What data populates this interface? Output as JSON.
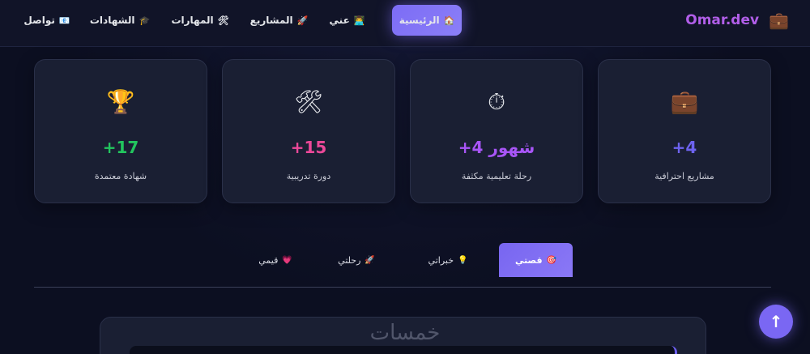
{
  "brand": {
    "name": "Omar.dev",
    "icon": "💼"
  },
  "nav": {
    "items": [
      {
        "label": "تواصل",
        "icon": "📧"
      },
      {
        "label": "الشهادات",
        "icon": "🎓"
      },
      {
        "label": "المهارات",
        "icon": "🛠"
      },
      {
        "label": "المشاريع",
        "icon": "🚀"
      },
      {
        "label": "عني",
        "icon": "👨‍💻"
      },
      {
        "label": "الرئيسية",
        "icon": "🏠",
        "active": true
      }
    ]
  },
  "stats": [
    {
      "icon": "🏆",
      "value": "+17",
      "label": "شهادة معتمدة",
      "color": "#22c55e"
    },
    {
      "icon": "🛠",
      "value": "+15",
      "label": "دورة تدريبية",
      "color": "#ec4899"
    },
    {
      "icon": "⏱",
      "value": "+4 شهور",
      "label": "رحلة تعليمية مكثفة",
      "color": "#a855f7"
    },
    {
      "icon": "💼",
      "value": "+4",
      "label": "مشاريع احترافية",
      "color": "#6d63f0"
    }
  ],
  "tabs": [
    {
      "label": "قيمي",
      "icon": "💗"
    },
    {
      "label": "رحلتي",
      "icon": "🚀"
    },
    {
      "label": "خبراتي",
      "icon": "💡"
    },
    {
      "label": "قصتي",
      "icon": "🎯",
      "active": true
    }
  ],
  "watermark": "خمسات",
  "scroll_top": {
    "icon": "↑"
  },
  "colors": {
    "accent": "#7c6cf5",
    "background": "#0c0f21",
    "card": "#1a1f33"
  }
}
